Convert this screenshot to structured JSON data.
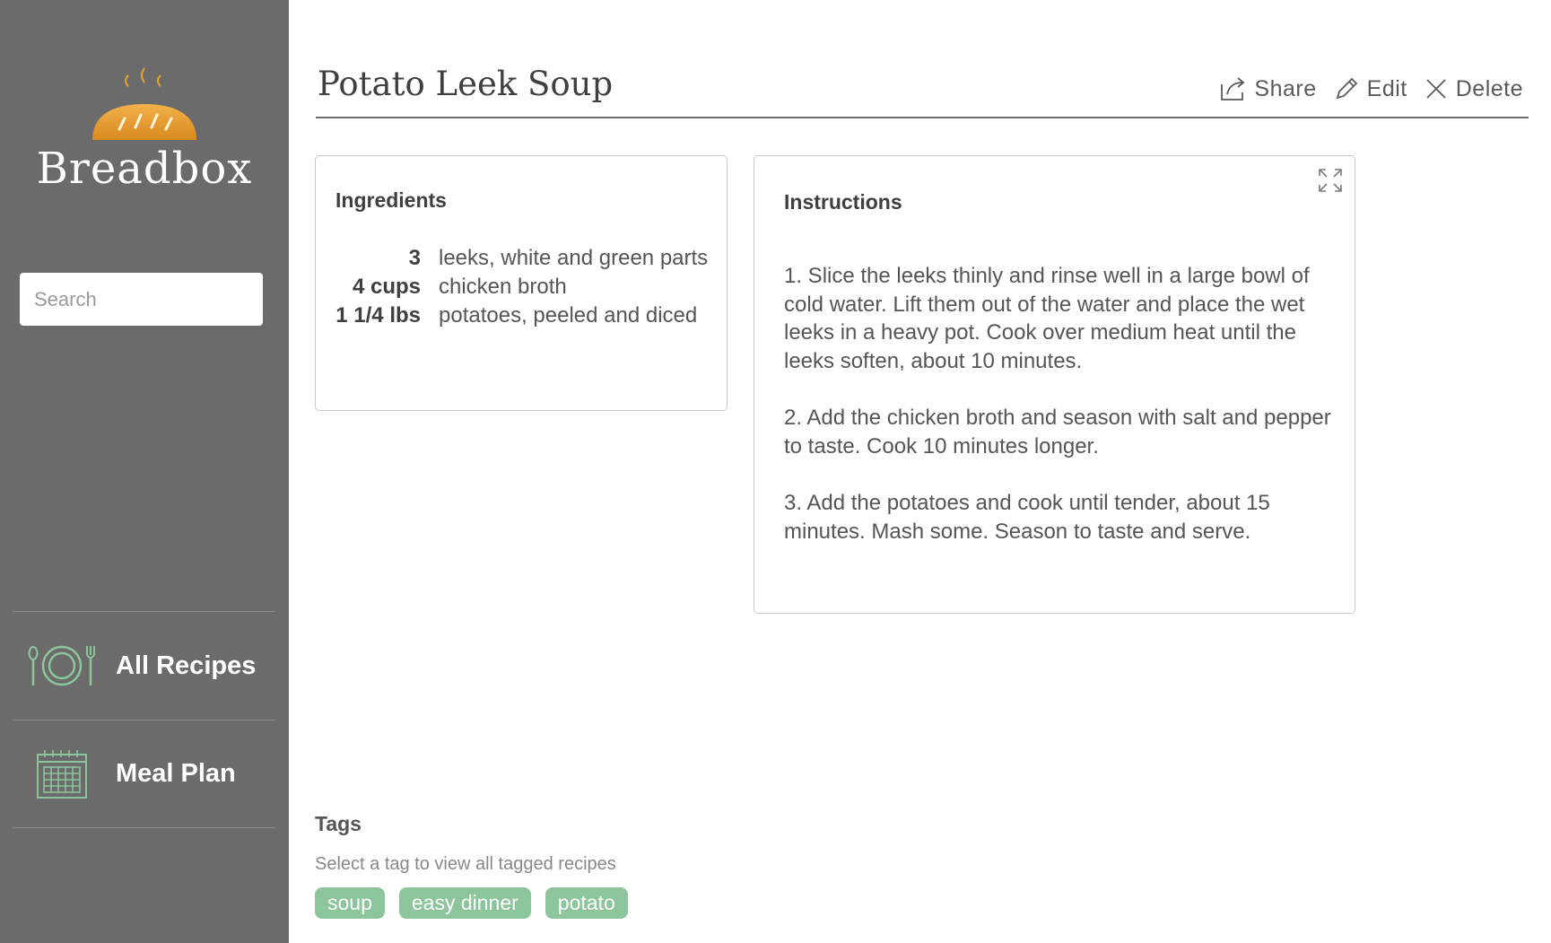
{
  "app": {
    "name": "Breadbox"
  },
  "search": {
    "placeholder": "Search"
  },
  "nav": {
    "items": [
      {
        "label": "All Recipes",
        "icon": "plate-utensils-icon"
      },
      {
        "label": "Meal Plan",
        "icon": "calendar-icon"
      }
    ]
  },
  "recipe": {
    "title": "Potato Leek Soup",
    "actions": {
      "share": "Share",
      "edit": "Edit",
      "delete": "Delete"
    },
    "ingredients": {
      "title": "Ingredients",
      "items": [
        {
          "qty": "3",
          "name": "leeks, white and green parts"
        },
        {
          "qty": "4 cups",
          "name": "chicken broth"
        },
        {
          "qty": "1 1/4 lbs",
          "name": "potatoes, peeled and diced"
        }
      ]
    },
    "instructions": {
      "title": "Instructions",
      "steps": [
        "1. Slice the leeks thinly and rinse well in a large bowl of cold water. Lift them out of the water and place the wet leeks in a heavy pot. Cook over medium heat until the leeks soften, about 10 minutes.",
        "2. Add the chicken broth and season with salt and pepper to taste. Cook 10 minutes longer.",
        "3. Add the potatoes and cook until tender, about 15 minutes. Mash some. Season to taste and serve."
      ]
    },
    "tags": {
      "title": "Tags",
      "hint": "Select a tag to view all tagged recipes",
      "items": [
        "soup",
        "easy dinner",
        "potato"
      ]
    }
  },
  "colors": {
    "sidebar": "#6b6b6b",
    "accent_green": "#8cc49c",
    "bread": "#e8a033"
  }
}
